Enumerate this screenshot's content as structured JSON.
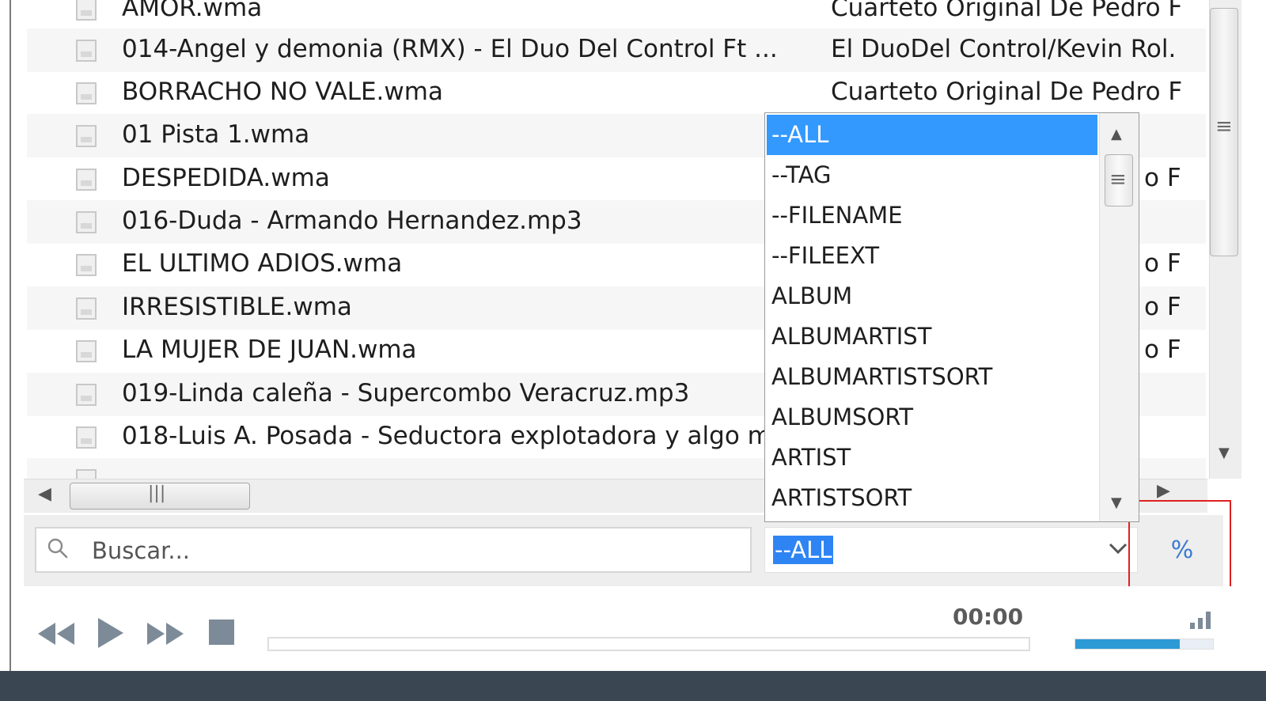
{
  "tracks": [
    {
      "title": "AMOR.wma",
      "artist": "Cuarteto Original De Pedro F"
    },
    {
      "title": "014-Angel y demonia (RMX) - El Duo Del Control Ft ...",
      "artist": "El DuoDel Control/Kevin Rol."
    },
    {
      "title": "BORRACHO NO VALE.wma",
      "artist": "Cuarteto Original De Pedro F"
    },
    {
      "title": "01 Pista 1.wma",
      "artist": ""
    },
    {
      "title": "DESPEDIDA.wma",
      "artist": "o F"
    },
    {
      "title": "016-Duda - Armando Hernandez.mp3",
      "artist": ""
    },
    {
      "title": "EL ULTIMO ADIOS.wma",
      "artist": "o F"
    },
    {
      "title": "IRRESISTIBLE.wma",
      "artist": "o F"
    },
    {
      "title": "LA MUJER DE JUAN.wma",
      "artist": "o F"
    },
    {
      "title": "019-Linda caleña - Supercombo Veracruz.mp3",
      "artist": ""
    },
    {
      "title": "018-Luis A. Posada - Seductora explotadora y algo m",
      "artist": ""
    }
  ],
  "dropdown": {
    "items": [
      "--ALL",
      "--TAG",
      "--FILENAME",
      "--FILEEXT",
      "ALBUM",
      "ALBUMARTIST",
      "ALBUMARTISTSORT",
      "ALBUMSORT",
      "ARTIST",
      "ARTISTSORT"
    ],
    "selected": "--ALL"
  },
  "search": {
    "placeholder": "Buscar...",
    "value": ""
  },
  "percent_label": "%",
  "player": {
    "time": "00:00",
    "progress": 0,
    "volume": 0.76
  },
  "colors": {
    "accent": "#3399ff",
    "highlight": "#e02020",
    "volume": "#2d9ad6"
  },
  "icons": {
    "file": "file-icon",
    "search": "search-icon",
    "chevron": "chevron-down-icon",
    "prev": "rewind-icon",
    "play": "play-icon",
    "next": "fast-forward-icon",
    "stop": "stop-icon",
    "volume": "signal-bars-icon"
  }
}
